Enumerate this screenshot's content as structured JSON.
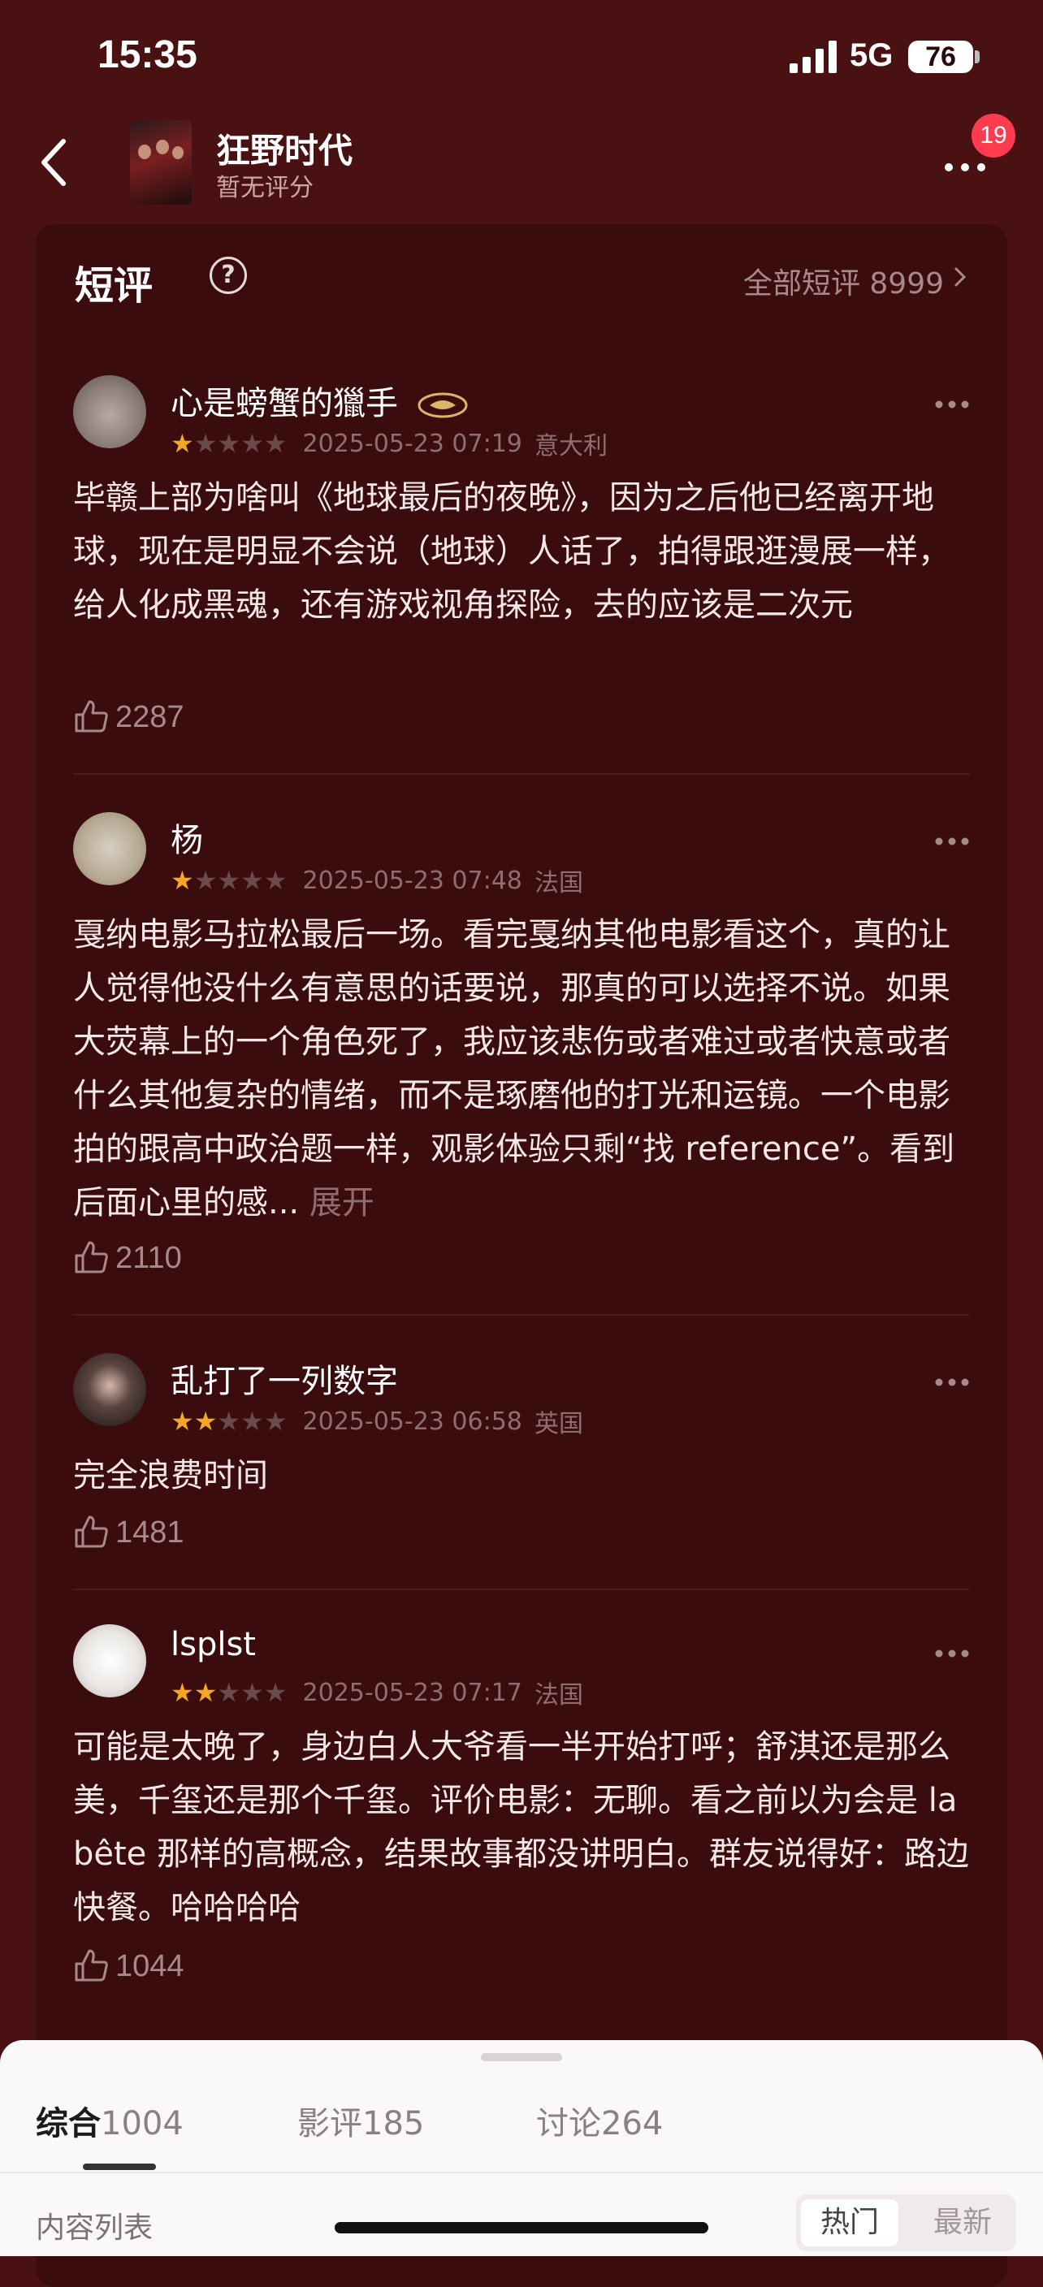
{
  "status_bar": {
    "time": "15:35",
    "network": "5G",
    "battery": "76"
  },
  "nav": {
    "movie_title": "狂野时代",
    "movie_rating": "暂无评分",
    "notification_count": "19"
  },
  "section": {
    "title": "短评",
    "help_symbol": "?",
    "all_link": "全部短评 8999"
  },
  "reviews": [
    {
      "username": "心是螃蟹的獵手",
      "stars": 1,
      "date": "2025-05-23 07:19",
      "location": "意大利",
      "content": "毕赣上部为啥叫《地球最后的夜晚》，因为之后他已经离开地球，现在是明显不会说（地球）人话了，拍得跟逛漫展一样，给人化成黑魂，还有游戏视角探险，去的应该是二次元",
      "likes": "2287"
    },
    {
      "username": "杨",
      "stars": 1,
      "date": "2025-05-23 07:48",
      "location": "法国",
      "content": "戛纳电影马拉松最后一场。看完戛纳其他电影看这个，真的让人觉得他没什么有意思的话要说，那真的可以选择不说。如果大荧幕上的一个角色死了，我应该悲伤或者难过或者快意或者什么其他复杂的情绪，而不是琢磨他的打光和运镜。一个电影拍的跟高中政治题一样，观影体验只剩“找 reference”。看到后面心里的感...",
      "expand": "展开",
      "likes": "2110"
    },
    {
      "username": "乱打了一列数字",
      "stars": 2,
      "date": "2025-05-23 06:58",
      "location": "英国",
      "content": "完全浪费时间",
      "likes": "1481"
    },
    {
      "username": "lsplst",
      "stars": 2,
      "date": "2025-05-23 07:17",
      "location": "法国",
      "content": "可能是太晚了，身边白人大爷看一半开始打呼；舒淇还是那么美，千玺还是那个千玺。评价电影：无聊。看之前以为会是 la bête 那样的高概念，结果故事都没讲明白。群友说得好：路边快餐。哈哈哈哈",
      "likes": "1044"
    }
  ],
  "bottom_sheet": {
    "tabs": [
      {
        "label": "综合",
        "count": "1004"
      },
      {
        "label": "影评",
        "count": "185"
      },
      {
        "label": "讨论",
        "count": "264"
      }
    ],
    "list_label": "内容列表",
    "sort_hot": "热门",
    "sort_new": "最新"
  },
  "colors": {
    "background": "#4a1113",
    "card": "#3a0c0e",
    "star": "#f5a623",
    "badge": "#ff3b4f"
  }
}
